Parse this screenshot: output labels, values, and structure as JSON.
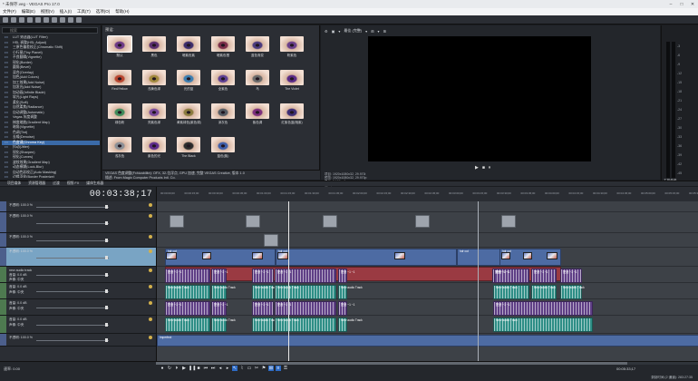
{
  "window": {
    "title": "* 未保存.veg - VEGAS Pro 17.0",
    "controls": [
      "–",
      "□",
      "✕"
    ]
  },
  "menu": [
    "文件(F)",
    "编辑(E)",
    "视图(V)",
    "插入(I)",
    "工具(T)",
    "选项(O)",
    "帮助(H)"
  ],
  "fx": {
    "search_placeholder": "搜索",
    "items": [
      "LUT 筛选器(LUT Filter)",
      "HSL 调整(HSL Adjust)",
      "三原色偏差校正(Chromatic Shift)",
      "小行星(Tiny Planet)",
      "不良翻辑(Vignette)",
      "锐化(Border)",
      "圆角(Bevel)",
      "混合(Overlay)",
      "加色(Add Colors)",
      "加工效果(Add Noise)",
      "加发光(Add Noise)",
      "加动画(Infinite Blade)",
      "软光(Light Rays)",
      "柔化(Soft)",
      "自然柔焦(Radiance)",
      "自动调整(Automatic)",
      "Vegas 灰度调整",
      "梯度缩放(Gradient Map)",
      "暗角(Vignette)",
      "色调(Tint)",
      "去噪(Denoise)",
      "色度键(Chroma Key)",
      "抖动(Jitter)",
      "锐化(Sharpen)",
      "锐化(Curves)",
      "波纹效果(Gradient Map)",
      "动态模糊(Lock-Blur)",
      "自动色彩校正(Auto Masking)",
      "边缘羽化(Border Posterize)",
      "光效(Light Rays)",
      "亮度对比度(Brightness and Contrast)",
      "定位(Offset)",
      "软对比度(Soft Contrast)",
      "胶片颗粒(Grain)",
      "冲压(Emboss)",
      "颜色曲线(Color)",
      "马赛克(Mosaic)",
      "光照(Light)",
      "晃动效果(Shake)",
      "镜像(Mirror)",
      "随着颜色(Dissolve Blur)",
      "色度扩散(Color Curve)",
      "缩放(Zoom)",
      "加大(Magnify)",
      "暗化(Dither)",
      "全画面(Dark Color)"
    ],
    "selected_index": 21
  },
  "presets": {
    "title": "预设:",
    "items": [
      "默认",
      "黑色",
      "暗紫色紫",
      "暗紫色橙",
      "蓝色渐变",
      "粉紫色",
      "Red/Yellow",
      "浅黄色绿",
      "光的蓝",
      "全紫色",
      "乌",
      "The Violet",
      "绿色粉",
      "亮紫色绿",
      "黄紫绿色(紫色调)",
      "深灰色",
      "紫色调",
      "红紫色蓝(暗紫)",
      "浅灰色",
      "紫色的光",
      "The Black",
      "蓝色(紫)"
    ],
    "selected_index": 0,
    "status": "VEGAS 色度调整(Fxhizabilite): OFX, 32-位浮点, GPU 加速, 完整 VEGAS Creative, 版本 1.0",
    "status2": "描述: From Magix Computer Products Intl. Co."
  },
  "preview": {
    "toolbar": [
      "⚙",
      "▣",
      "▾",
      "最佳 (完整)",
      "▾",
      "⊞",
      "▾",
      "⊞"
    ],
    "controls": [
      "▶",
      "■",
      "⏸"
    ],
    "info": [
      "项目: 1920x1080x32, 29.970i",
      "预览: 1920x1080x32, 29.970p",
      "显示: 2,109 x 9",
      "帧: 1,399"
    ]
  },
  "vu": {
    "scale": [
      "-3",
      "-6",
      "-9",
      "-12",
      "-15",
      "-18",
      "-21",
      "-24",
      "-27",
      "-30",
      "-33",
      "-36",
      "-39",
      "-42",
      "-45",
      "-48",
      "-51",
      "-54",
      "-57"
    ],
    "label": "主控总线"
  },
  "tabs": [
    "项目媒体",
    "资源管理器",
    "过渡",
    "视频 FX",
    "媒体生成器"
  ],
  "timeline": {
    "timecode": "00:03:38;17",
    "ruler": [
      "00:00:00;00",
      "00:00:15;00",
      "00:00:30;00",
      "00:00:45;00",
      "00:01:00;00",
      "00:01:15;00",
      "00:01:30;00",
      "00:01:45;00",
      "00:02:00;00",
      "00:02:15;00",
      "00:02:30;00",
      "00:02:45;00",
      "00:03:00;00",
      "00:03:15;00",
      "00:03:30;00",
      "00:03:45;00",
      "00:04:00;00",
      "00:04:15;00",
      "00:04:30;00",
      "00:04:45;00",
      "00:05:00;00",
      "00:05:15;00",
      "00:05:30;00"
    ],
    "tracks": [
      {
        "type": "video",
        "level": "不透明: 100.0 %"
      },
      {
        "type": "video",
        "level": "不透明: 100.0 %"
      },
      {
        "type": "video",
        "level": "不透明: 100.0 %"
      },
      {
        "type": "video",
        "level": "不透明: 100.0 %"
      },
      {
        "type": "audio",
        "name": "new audio track",
        "vol": "音量: 0.0 dB",
        "pan": "声像: 中央"
      },
      {
        "type": "audio",
        "vol": "音量: 0.0 dB",
        "pan": "声像: 中央"
      },
      {
        "type": "audio",
        "vol": "音量: 0.0 dB",
        "pan": "声像: 中央"
      },
      {
        "type": "audio",
        "vol": "音量: 0.0 dB",
        "pan": "声像: 中央"
      },
      {
        "type": "video",
        "level": "不透明: 100.0 %"
      }
    ],
    "clip_labels": {
      "video": "hdr cut",
      "audio_a": "配音 ~1 ~1",
      "audio_b": "New audio Track",
      "bottom": "Imperfect"
    }
  },
  "bottom": {
    "rate": "速率: 0.00",
    "end_time": "00:05:33;17",
    "status": "录制时间 (2 通道): 283:27:35"
  }
}
